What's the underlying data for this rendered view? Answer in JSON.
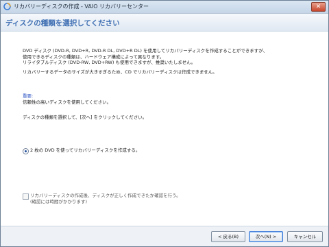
{
  "window": {
    "title": "リカバリーディスクの作成 - VAIO リカバリーセンター",
    "close_glyph": "✕"
  },
  "header": {
    "title": "ディスクの種類を選択してください"
  },
  "content": {
    "para1": [
      "DVD ディスク (DVD-R, DVD+R, DVD-R DL, DVD+R DL) を使用してリカバリーディスクを作成することができますが、",
      "使用できるディスクの種類は、ハードウェア構成によって異なります。",
      "リライタブルディスク (DVD-RW, DVD+RW) も使用できますが、推奨いたしません。"
    ],
    "para2": "リカバリーするデータのサイズが大きすぎるため、CD でリカバリーディスクは作成できません。",
    "important_label": "重要:",
    "important_text": "信頼性の高いディスクを使用してください。",
    "instruction": "ディスクの種類を選択して、[次へ] をクリックしてください。",
    "radio_option": "2 枚の DVD を使ってリカバリーディスクを作成する。",
    "verify_checkbox": [
      "リカバリーディスクの作成後、ディスクが正しく作成できたか確認を行う。",
      "(確認には時間がかかります)"
    ]
  },
  "buttons": {
    "back": "< 戻る(B)",
    "next": "次へ(N) >",
    "cancel": "キャンセル"
  }
}
